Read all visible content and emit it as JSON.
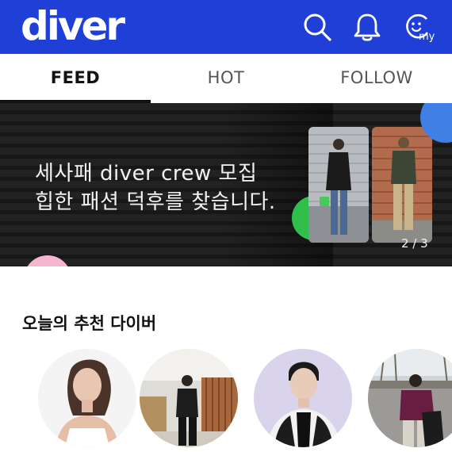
{
  "app": {
    "logo_text": "diver",
    "brand_color": "#1f3fd6"
  },
  "header_icons": [
    {
      "name": "search-icon"
    },
    {
      "name": "bell-icon"
    },
    {
      "name": "my-icon",
      "label": "my"
    }
  ],
  "tabs": [
    {
      "label": "FEED",
      "active": true
    },
    {
      "label": "HOT",
      "active": false
    },
    {
      "label": "FOLLOW",
      "active": false
    }
  ],
  "banner": {
    "line1": "세사패 diver crew 모집",
    "line2": "힙한 패션 덕후를 찾습니다.",
    "counter": "2 / 3"
  },
  "recommended": {
    "title": "오늘의 추천 다이버"
  }
}
